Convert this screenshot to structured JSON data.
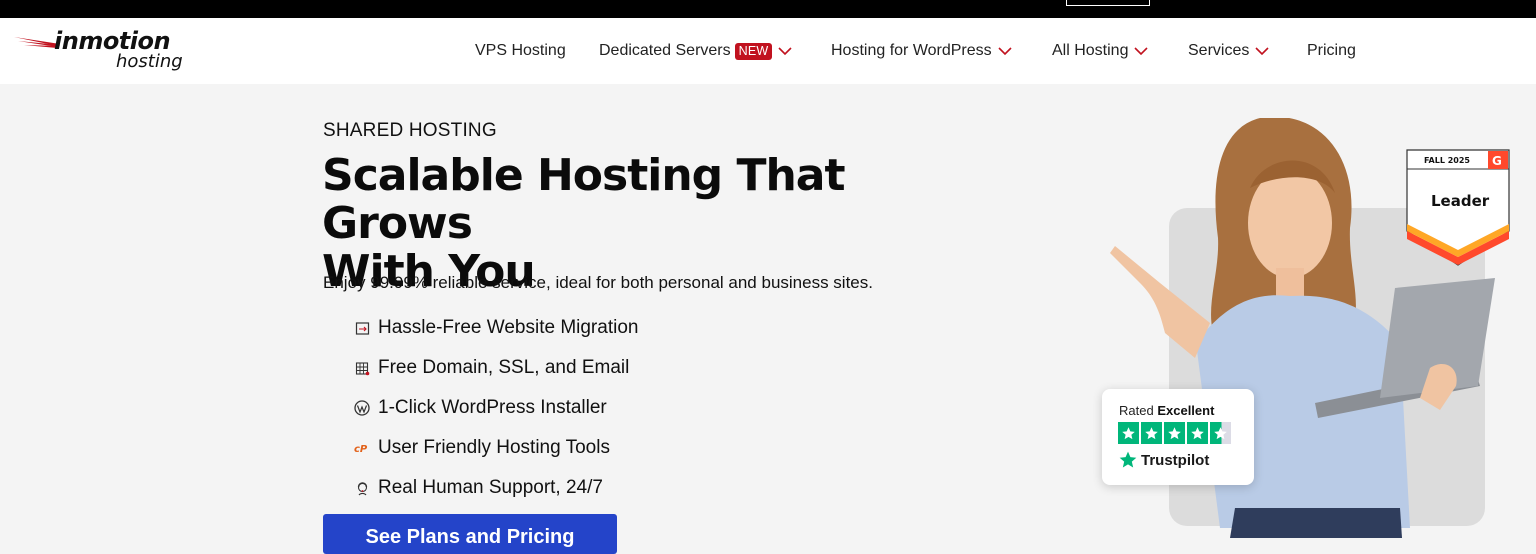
{
  "brand": {
    "name": "inmotion",
    "sub": "hosting",
    "accent": "#c1121f"
  },
  "nav": {
    "items": [
      {
        "label": "VPS Hosting",
        "has_menu": false
      },
      {
        "label": "Dedicated Servers",
        "badge": "NEW",
        "has_menu": true
      },
      {
        "label": "Hosting for WordPress",
        "has_menu": true
      },
      {
        "label": "All Hosting",
        "has_menu": true
      },
      {
        "label": "Services",
        "has_menu": true
      },
      {
        "label": "Pricing",
        "has_menu": false
      }
    ]
  },
  "hero": {
    "eyebrow": "SHARED HOSTING",
    "title_line1": "Scalable Hosting That Grows",
    "title_line2": "With You",
    "lede": "Enjoy 99.99% reliable service, ideal for both personal and business sites.",
    "features": [
      {
        "label": "Hassle-Free Website Migration",
        "icon": "migration-icon"
      },
      {
        "label": "Free Domain, SSL, and Email",
        "icon": "domain-icon"
      },
      {
        "label": "1-Click WordPress Installer",
        "icon": "wordpress-icon"
      },
      {
        "label": "User Friendly Hosting Tools",
        "icon": "cpanel-icon"
      },
      {
        "label": "Real Human Support, 24/7",
        "icon": "support-icon"
      }
    ],
    "cta_label": "See Plans and Pricing",
    "cta_color": "#2444c9"
  },
  "g2_badge": {
    "season": "FALL 2025",
    "title": "Leader",
    "logo": "G"
  },
  "trustpilot": {
    "rated": "Rated",
    "rating_word": "Excellent",
    "brand": "Trustpilot",
    "stars": 4.5,
    "color": "#00b67a"
  }
}
